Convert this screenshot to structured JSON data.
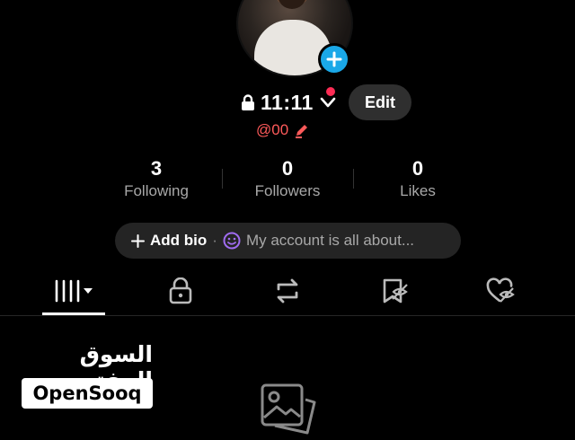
{
  "profile": {
    "username": "11:11",
    "handle": "@00",
    "edit_label": "Edit"
  },
  "stats": [
    {
      "count": "3",
      "label": "Following"
    },
    {
      "count": "0",
      "label": "Followers"
    },
    {
      "count": "0",
      "label": "Likes"
    }
  ],
  "bio": {
    "add_label": "Add bio",
    "separator": "·",
    "placeholder": "My account is all about..."
  },
  "tabs": [
    {
      "icon": "grid-icon",
      "active": true
    },
    {
      "icon": "lock-icon",
      "active": false
    },
    {
      "icon": "repost-icon",
      "active": false
    },
    {
      "icon": "bookmark-icon",
      "active": false
    },
    {
      "icon": "liked-icon",
      "active": false
    }
  ],
  "watermark": {
    "arabic": "السوق المفتوح",
    "latin": "OpenSooq"
  },
  "colors": {
    "accent_blue": "#1aa8e8",
    "notification_red": "#fe2c55",
    "handle_red": "#fe5a5a",
    "background": "#000000",
    "secondary_text": "#a8a8a8"
  }
}
